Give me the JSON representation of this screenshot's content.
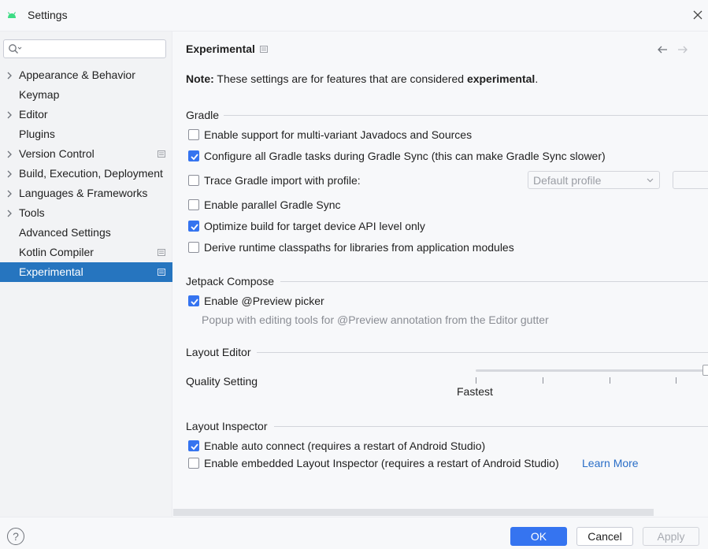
{
  "window": {
    "title": "Settings",
    "app_icon": "android-icon",
    "close_icon": "close-icon"
  },
  "sidebar": {
    "search_placeholder": "",
    "items": [
      {
        "label": "Appearance & Behavior",
        "expandable": true
      },
      {
        "label": "Keymap",
        "expandable": false
      },
      {
        "label": "Editor",
        "expandable": true
      },
      {
        "label": "Plugins",
        "expandable": false
      },
      {
        "label": "Version Control",
        "expandable": true,
        "project_icon": true
      },
      {
        "label": "Build, Execution, Deployment",
        "expandable": true
      },
      {
        "label": "Languages & Frameworks",
        "expandable": true
      },
      {
        "label": "Tools",
        "expandable": true
      },
      {
        "label": "Advanced Settings",
        "expandable": false
      },
      {
        "label": "Kotlin Compiler",
        "expandable": false,
        "project_icon": true
      },
      {
        "label": "Experimental",
        "expandable": false,
        "project_icon": true,
        "selected": true
      }
    ]
  },
  "content": {
    "title": "Experimental",
    "note_prefix": "Note:",
    "note_text": " These settings are for features that are considered ",
    "note_bold": "experimental",
    "note_suffix": ".",
    "gradle": {
      "heading": "Gradle",
      "multi_variant": {
        "label": "Enable support for multi-variant Javadocs and Sources",
        "checked": false
      },
      "configure_all": {
        "label": "Configure all Gradle tasks during Gradle Sync (this can make Gradle Sync slower)",
        "checked": true
      },
      "trace_import": {
        "label": "Trace Gradle import with profile:",
        "checked": false
      },
      "profile_dropdown": "Default profile",
      "parallel_sync": {
        "label": "Enable parallel Gradle Sync",
        "checked": false
      },
      "optimize_build": {
        "label": "Optimize build for target device API level only",
        "checked": true
      },
      "derive_classpaths": {
        "label": "Derive runtime classpaths for libraries from application modules",
        "checked": false
      }
    },
    "jetpack": {
      "heading": "Jetpack Compose",
      "preview_picker": {
        "label": "Enable @Preview picker",
        "checked": true
      },
      "preview_hint": "Popup with editing tools for @Preview annotation from the Editor gutter"
    },
    "layout_editor": {
      "heading": "Layout Editor",
      "quality_label": "Quality Setting",
      "slider_min_label": "Fastest",
      "slider_level": 1.0
    },
    "layout_inspector": {
      "heading": "Layout Inspector",
      "auto_connect": {
        "label": "Enable auto connect (requires a restart of Android Studio)",
        "checked": true
      },
      "embedded": {
        "label": "Enable embedded Layout Inspector (requires a restart of Android Studio)",
        "checked": false
      },
      "learn_more": "Learn More"
    }
  },
  "footer": {
    "help": "?",
    "ok": "OK",
    "cancel": "Cancel",
    "apply": "Apply"
  },
  "colors": {
    "accent": "#3574f0",
    "selection": "#2675bf",
    "link": "#2a6ec7"
  }
}
